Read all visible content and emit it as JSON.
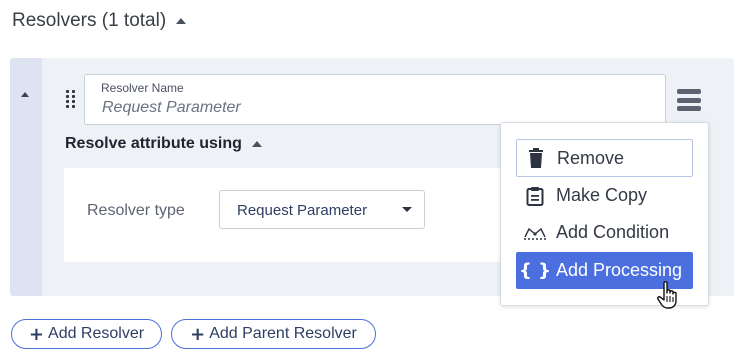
{
  "section": {
    "title": "Resolvers (1 total)"
  },
  "resolver": {
    "name_label": "Resolver Name",
    "name_value": "Request Parameter",
    "resolve_heading": "Resolve attribute using",
    "type_label": "Resolver type",
    "type_value": "Request Parameter"
  },
  "menu": {
    "items": [
      {
        "label": "Remove",
        "icon": "trash-icon"
      },
      {
        "label": "Make Copy",
        "icon": "clipboard-icon"
      },
      {
        "label": "Add Condition",
        "icon": "condition-icon"
      },
      {
        "label": "Add Processing",
        "icon": "braces-icon",
        "glyph": "{ }",
        "highlighted": true
      }
    ]
  },
  "buttons": {
    "add_resolver": "Add Resolver",
    "add_parent_resolver": "Add Parent Resolver",
    "plus": "+"
  },
  "colors": {
    "accent": "#4c6fe0",
    "card_bg": "#eef1f6",
    "strip_bg": "#dde3f0"
  }
}
